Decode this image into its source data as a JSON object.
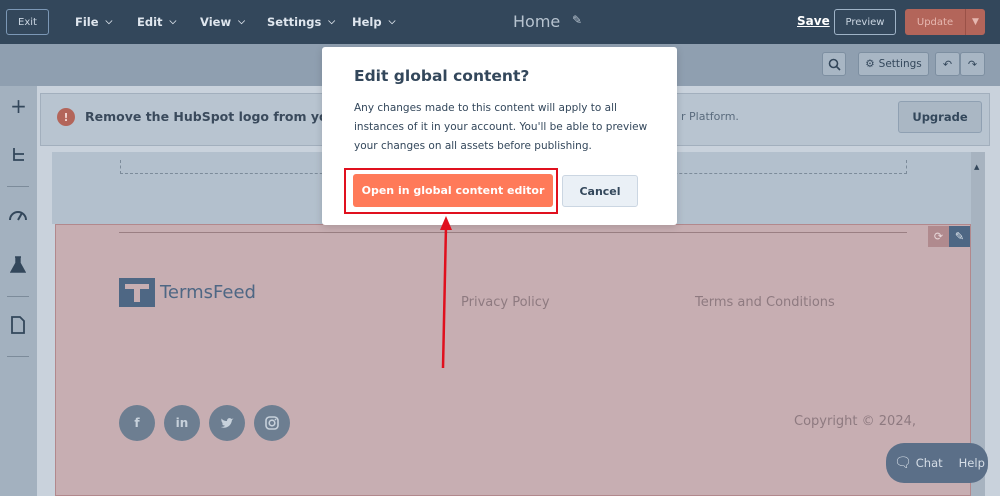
{
  "topbar": {
    "exit_label": "Exit",
    "menus": [
      "File",
      "Edit",
      "View",
      "Settings",
      "Help"
    ],
    "page_title": "Home",
    "save_label": "Save",
    "preview_label": "Preview",
    "update_label": "Update"
  },
  "toolbar": {
    "settings_label": "Settings"
  },
  "banner": {
    "message": "Remove the HubSpot logo from your",
    "message_tail": "r Platform.",
    "upgrade_label": "Upgrade"
  },
  "footer": {
    "brand_name": "TermsFeed",
    "links": [
      "Privacy Policy",
      "Terms and Conditions"
    ],
    "copyright": "Copyright © 2024,",
    "social": [
      "f",
      "in",
      "",
      ""
    ]
  },
  "chat": {
    "chat_label": "Chat",
    "help_label": "Help"
  },
  "modal": {
    "title": "Edit global content?",
    "body": "Any changes made to this content will apply to all instances of it in your account. You'll be able to preview your changes on all assets before publishing.",
    "primary_label": "Open in global content editor",
    "cancel_label": "Cancel"
  },
  "colors": {
    "header": "#33475b",
    "primary": "#ff7a59",
    "highlight": "#e0101e"
  }
}
